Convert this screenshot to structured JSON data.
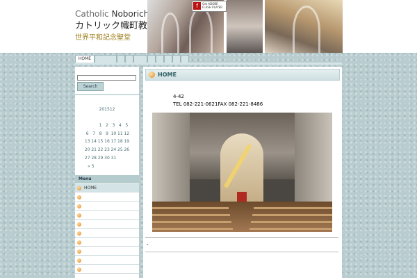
{
  "header": {
    "brand_line1_a": "Catholic",
    "brand_line1_b": "Noboricho",
    "brand_line2": "カトリック幟町教会",
    "brand_line3": "世界平和記念聖堂",
    "flash_badge_text": "Get ADOBE FLASH PLAYER",
    "flash_icon": "flash-player-icon"
  },
  "nav": {
    "tabs": [
      "HOME",
      "",
      "",
      "",
      "",
      "",
      "",
      "",
      "",
      ""
    ]
  },
  "sidebar": {
    "search_value": "",
    "search_button": "Search",
    "calendar": {
      "caption": "201512",
      "weeks": [
        [
          "",
          "",
          "1",
          "2",
          "3",
          "4",
          "5"
        ],
        [
          "6",
          "7",
          "8",
          "9",
          "10",
          "11",
          "12"
        ],
        [
          "13",
          "14",
          "15",
          "16",
          "17",
          "18",
          "19"
        ],
        [
          "20",
          "21",
          "22",
          "23",
          "24",
          "25",
          "26"
        ],
        [
          "27",
          "28",
          "29",
          "30",
          "31",
          "",
          ""
        ]
      ],
      "nav_prev": "« 5"
    },
    "menu": {
      "title": "Menu",
      "items": [
        "HOME",
        "",
        "",
        "",
        "",
        "",
        "",
        "",
        "",
        ""
      ]
    }
  },
  "main": {
    "title": "HOME",
    "address_line1": "4-42",
    "address_line2": "TEL 082-221-0621FAX 082-221-8486",
    "footer_text": "-"
  },
  "colors": {
    "background": "#b9cdd0",
    "accent": "#2c5d63",
    "brand_gold": "#a0801e",
    "bullet": "#e08a1e"
  }
}
